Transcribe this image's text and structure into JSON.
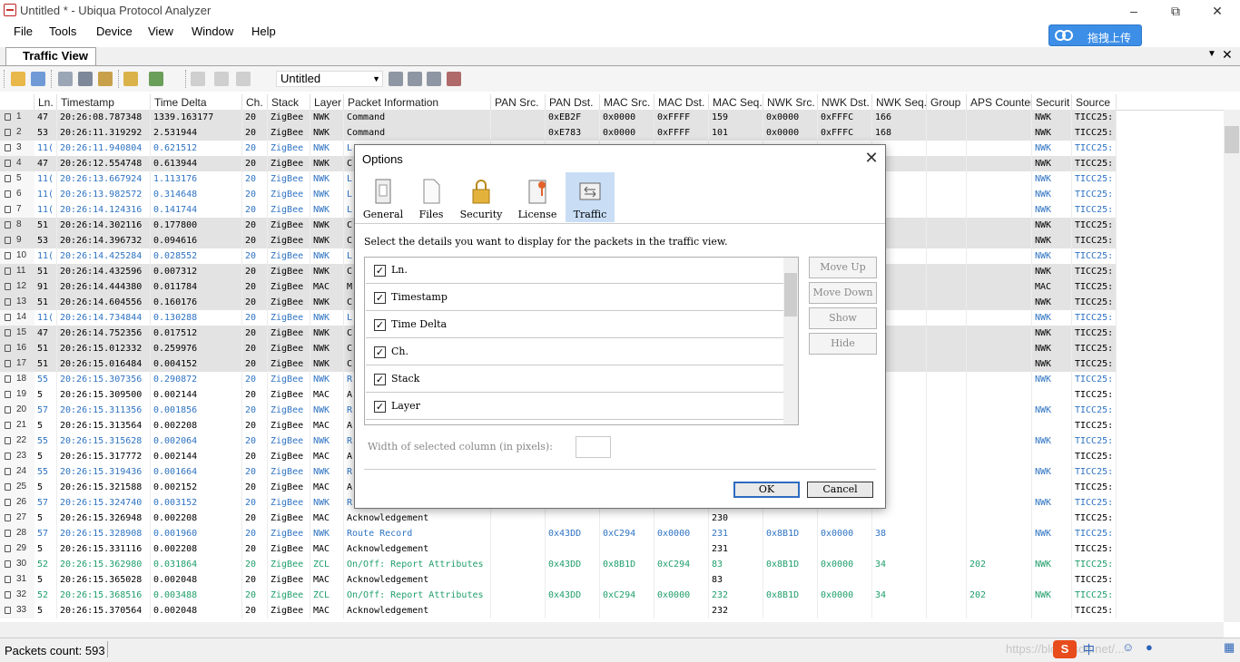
{
  "window": {
    "title": "Untitled * - Ubiqua Protocol Analyzer"
  },
  "menu": [
    "File",
    "Tools",
    "Device",
    "View",
    "Window",
    "Help"
  ],
  "cloud_button": {
    "label": "拖拽上传"
  },
  "tab": {
    "label": "Traffic View"
  },
  "toolbar": {
    "combo_value": "Untitled"
  },
  "columns": [
    "Ln.",
    "Timestamp",
    "Time Delta",
    "Ch.",
    "Stack",
    "Layer",
    "Packet Information",
    "PAN Src.",
    "PAN Dst.",
    "MAC Src.",
    "MAC Dst.",
    "MAC Seq.",
    "NWK Src.",
    "NWK Dst.",
    "NWK Seq.",
    "Group",
    "APS Counter",
    "Securit",
    "Source"
  ],
  "rows": [
    {
      "n": "1",
      "ln": "47",
      "ts": "20:26:08.787348",
      "td": "1339.163177",
      "ch": "20",
      "st": "ZigBee",
      "ly": "NWK",
      "pi": "Command",
      "ps": "",
      "pd": "0xEB2F",
      "ms": "0x0000",
      "md": "0xFFFF",
      "mq": "159",
      "ns": "0x0000",
      "nd": "0xFFFC",
      "nq": "166",
      "gr": "",
      "ac": "",
      "se": "NWK",
      "so": "TICC25:"
    },
    {
      "n": "2",
      "ln": "53",
      "ts": "20:26:11.319292",
      "td": "2.531944",
      "ch": "20",
      "st": "ZigBee",
      "ly": "NWK",
      "pi": "Command",
      "ps": "",
      "pd": "0xE783",
      "ms": "0x0000",
      "md": "0xFFFF",
      "mq": "101",
      "ns": "0x0000",
      "nd": "0xFFFC",
      "nq": "168",
      "gr": "",
      "ac": "",
      "se": "NWK",
      "so": "TICC25:"
    },
    {
      "n": "3",
      "ln": "11(",
      "ts": "20:26:11.940804",
      "td": "0.621512",
      "ch": "20",
      "st": "ZigBee",
      "ly": "NWK",
      "pi": "L",
      "ps": "",
      "pd": "",
      "ms": "",
      "md": "",
      "mq": "",
      "ns": "",
      "nd": "",
      "nq": "",
      "gr": "",
      "ac": "",
      "se": "NWK",
      "so": "TICC25:"
    },
    {
      "n": "4",
      "ln": "47",
      "ts": "20:26:12.554748",
      "td": "0.613944",
      "ch": "20",
      "st": "ZigBee",
      "ly": "NWK",
      "pi": "C",
      "ps": "",
      "pd": "",
      "ms": "",
      "md": "",
      "mq": "",
      "ns": "",
      "nd": "",
      "nq": "",
      "gr": "",
      "ac": "",
      "se": "NWK",
      "so": "TICC25:"
    },
    {
      "n": "5",
      "ln": "11(",
      "ts": "20:26:13.667924",
      "td": "1.113176",
      "ch": "20",
      "st": "ZigBee",
      "ly": "NWK",
      "pi": "L",
      "ps": "",
      "pd": "",
      "ms": "",
      "md": "",
      "mq": "",
      "ns": "",
      "nd": "",
      "nq": "00",
      "gr": "",
      "ac": "",
      "se": "NWK",
      "so": "TICC25:"
    },
    {
      "n": "6",
      "ln": "11(",
      "ts": "20:26:13.982572",
      "td": "0.314648",
      "ch": "20",
      "st": "ZigBee",
      "ly": "NWK",
      "pi": "L",
      "ps": "",
      "pd": "",
      "ms": "",
      "md": "",
      "mq": "",
      "ns": "",
      "nd": "",
      "nq": "5",
      "gr": "",
      "ac": "",
      "se": "NWK",
      "so": "TICC25:"
    },
    {
      "n": "7",
      "ln": "11(",
      "ts": "20:26:14.124316",
      "td": "0.141744",
      "ch": "20",
      "st": "ZigBee",
      "ly": "NWK",
      "pi": "L",
      "ps": "",
      "pd": "",
      "ms": "",
      "md": "",
      "mq": "",
      "ns": "",
      "nd": "",
      "nq": "37",
      "gr": "",
      "ac": "",
      "se": "NWK",
      "so": "TICC25:"
    },
    {
      "n": "8",
      "ln": "51",
      "ts": "20:26:14.302116",
      "td": "0.177800",
      "ch": "20",
      "st": "ZigBee",
      "ly": "NWK",
      "pi": "C",
      "ps": "",
      "pd": "",
      "ms": "",
      "md": "",
      "mq": "",
      "ns": "",
      "nd": "",
      "nq": "59",
      "gr": "",
      "ac": "",
      "se": "NWK",
      "so": "TICC25:"
    },
    {
      "n": "9",
      "ln": "53",
      "ts": "20:26:14.396732",
      "td": "0.094616",
      "ch": "20",
      "st": "ZigBee",
      "ly": "NWK",
      "pi": "C",
      "ps": "",
      "pd": "",
      "ms": "",
      "md": "",
      "mq": "",
      "ns": "",
      "nd": "",
      "nq": "",
      "gr": "",
      "ac": "",
      "se": "NWK",
      "so": "TICC25:"
    },
    {
      "n": "10",
      "ln": "11(",
      "ts": "20:26:14.425284",
      "td": "0.028552",
      "ch": "20",
      "st": "ZigBee",
      "ly": "NWK",
      "pi": "L",
      "ps": "",
      "pd": "",
      "ms": "",
      "md": "",
      "mq": "",
      "ns": "",
      "nd": "",
      "nq": "00",
      "gr": "",
      "ac": "",
      "se": "NWK",
      "so": "TICC25:"
    },
    {
      "n": "11",
      "ln": "51",
      "ts": "20:26:14.432596",
      "td": "0.007312",
      "ch": "20",
      "st": "ZigBee",
      "ly": "NWK",
      "pi": "C",
      "ps": "",
      "pd": "",
      "ms": "",
      "md": "",
      "mq": "",
      "ns": "",
      "nd": "",
      "nq": "59",
      "gr": "",
      "ac": "",
      "se": "NWK",
      "so": "TICC25:"
    },
    {
      "n": "12",
      "ln": "91",
      "ts": "20:26:14.444380",
      "td": "0.011784",
      "ch": "20",
      "st": "ZigBee",
      "ly": "MAC",
      "pi": "M",
      "ps": "",
      "pd": "",
      "ms": "",
      "md": "",
      "mq": "",
      "ns": "",
      "nd": "",
      "nq": "",
      "gr": "",
      "ac": "",
      "se": "MAC",
      "so": "TICC25:"
    },
    {
      "n": "13",
      "ln": "51",
      "ts": "20:26:14.604556",
      "td": "0.160176",
      "ch": "20",
      "st": "ZigBee",
      "ly": "NWK",
      "pi": "C",
      "ps": "",
      "pd": "",
      "ms": "",
      "md": "",
      "mq": "",
      "ns": "",
      "nd": "",
      "nq": "59",
      "gr": "",
      "ac": "",
      "se": "NWK",
      "so": "TICC25:"
    },
    {
      "n": "14",
      "ln": "11(",
      "ts": "20:26:14.734844",
      "td": "0.130288",
      "ch": "20",
      "st": "ZigBee",
      "ly": "NWK",
      "pi": "L",
      "ps": "",
      "pd": "",
      "ms": "",
      "md": "",
      "mq": "",
      "ns": "",
      "nd": "",
      "nq": "",
      "gr": "",
      "ac": "",
      "se": "NWK",
      "so": "TICC25:"
    },
    {
      "n": "15",
      "ln": "47",
      "ts": "20:26:14.752356",
      "td": "0.017512",
      "ch": "20",
      "st": "ZigBee",
      "ly": "NWK",
      "pi": "C",
      "ps": "",
      "pd": "",
      "ms": "",
      "md": "",
      "mq": "",
      "ns": "",
      "nd": "",
      "nq": "",
      "gr": "",
      "ac": "",
      "se": "NWK",
      "so": "TICC25:"
    },
    {
      "n": "16",
      "ln": "51",
      "ts": "20:26:15.012332",
      "td": "0.259976",
      "ch": "20",
      "st": "ZigBee",
      "ly": "NWK",
      "pi": "C",
      "ps": "",
      "pd": "",
      "ms": "",
      "md": "",
      "mq": "",
      "ns": "",
      "nd": "",
      "nq": "59",
      "gr": "",
      "ac": "",
      "se": "NWK",
      "so": "TICC25:"
    },
    {
      "n": "17",
      "ln": "51",
      "ts": "20:26:15.016484",
      "td": "0.004152",
      "ch": "20",
      "st": "ZigBee",
      "ly": "NWK",
      "pi": "C",
      "ps": "",
      "pd": "",
      "ms": "",
      "md": "",
      "mq": "",
      "ns": "",
      "nd": "",
      "nq": "59",
      "gr": "",
      "ac": "",
      "se": "NWK",
      "so": "TICC25:"
    },
    {
      "n": "18",
      "ln": "55",
      "ts": "20:26:15.307356",
      "td": "0.290872",
      "ch": "20",
      "st": "ZigBee",
      "ly": "NWK",
      "pi": "R",
      "ps": "",
      "pd": "",
      "ms": "",
      "md": "",
      "mq": "",
      "ns": "",
      "nd": "",
      "nq": "2",
      "gr": "",
      "ac": "",
      "se": "NWK",
      "so": "TICC25:"
    },
    {
      "n": "19",
      "ln": "5",
      "ts": "20:26:15.309500",
      "td": "0.002144",
      "ch": "20",
      "st": "ZigBee",
      "ly": "MAC",
      "pi": "A",
      "ps": "",
      "pd": "",
      "ms": "",
      "md": "",
      "mq": "",
      "ns": "",
      "nd": "",
      "nq": "",
      "gr": "",
      "ac": "",
      "se": "",
      "so": "TICC25:"
    },
    {
      "n": "20",
      "ln": "57",
      "ts": "20:26:15.311356",
      "td": "0.001856",
      "ch": "20",
      "st": "ZigBee",
      "ly": "NWK",
      "pi": "R",
      "ps": "",
      "pd": "",
      "ms": "",
      "md": "",
      "mq": "",
      "ns": "",
      "nd": "",
      "nq": "2",
      "gr": "",
      "ac": "",
      "se": "NWK",
      "so": "TICC25:"
    },
    {
      "n": "21",
      "ln": "5",
      "ts": "20:26:15.313564",
      "td": "0.002208",
      "ch": "20",
      "st": "ZigBee",
      "ly": "MAC",
      "pi": "A",
      "ps": "",
      "pd": "",
      "ms": "",
      "md": "",
      "mq": "",
      "ns": "",
      "nd": "",
      "nq": "",
      "gr": "",
      "ac": "",
      "se": "",
      "so": "TICC25:"
    },
    {
      "n": "22",
      "ln": "55",
      "ts": "20:26:15.315628",
      "td": "0.002064",
      "ch": "20",
      "st": "ZigBee",
      "ly": "NWK",
      "pi": "R",
      "ps": "",
      "pd": "",
      "ms": "",
      "md": "",
      "mq": "",
      "ns": "",
      "nd": "",
      "nq": "5",
      "gr": "",
      "ac": "",
      "se": "NWK",
      "so": "TICC25:"
    },
    {
      "n": "23",
      "ln": "5",
      "ts": "20:26:15.317772",
      "td": "0.002144",
      "ch": "20",
      "st": "ZigBee",
      "ly": "MAC",
      "pi": "A",
      "ps": "",
      "pd": "",
      "ms": "",
      "md": "",
      "mq": "",
      "ns": "",
      "nd": "",
      "nq": "",
      "gr": "",
      "ac": "",
      "se": "",
      "so": "TICC25:"
    },
    {
      "n": "24",
      "ln": "55",
      "ts": "20:26:15.319436",
      "td": "0.001664",
      "ch": "20",
      "st": "ZigBee",
      "ly": "NWK",
      "pi": "R",
      "ps": "",
      "pd": "",
      "ms": "",
      "md": "",
      "mq": "",
      "ns": "",
      "nd": "",
      "nq": "8",
      "gr": "",
      "ac": "",
      "se": "NWK",
      "so": "TICC25:"
    },
    {
      "n": "25",
      "ln": "5",
      "ts": "20:26:15.321588",
      "td": "0.002152",
      "ch": "20",
      "st": "ZigBee",
      "ly": "MAC",
      "pi": "A",
      "ps": "",
      "pd": "",
      "ms": "",
      "md": "",
      "mq": "",
      "ns": "",
      "nd": "",
      "nq": "",
      "gr": "",
      "ac": "",
      "se": "",
      "so": "TICC25:"
    },
    {
      "n": "26",
      "ln": "57",
      "ts": "20:26:15.324740",
      "td": "0.003152",
      "ch": "20",
      "st": "ZigBee",
      "ly": "NWK",
      "pi": "R",
      "ps": "",
      "pd": "",
      "ms": "",
      "md": "",
      "mq": "",
      "ns": "",
      "nd": "",
      "nq": "",
      "gr": "",
      "ac": "",
      "se": "NWK",
      "so": "TICC25:"
    },
    {
      "n": "27",
      "ln": "5",
      "ts": "20:26:15.326948",
      "td": "0.002208",
      "ch": "20",
      "st": "ZigBee",
      "ly": "MAC",
      "pi": "Acknowledgement",
      "ps": "",
      "pd": "",
      "ms": "",
      "md": "",
      "mq": "230",
      "ns": "",
      "nd": "",
      "nq": "",
      "gr": "",
      "ac": "",
      "se": "",
      "so": "TICC25:"
    },
    {
      "n": "28",
      "ln": "57",
      "ts": "20:26:15.328908",
      "td": "0.001960",
      "ch": "20",
      "st": "ZigBee",
      "ly": "NWK",
      "pi": "Route Record",
      "ps": "",
      "pd": "0x43DD",
      "ms": "0xC294",
      "md": "0x0000",
      "mq": "231",
      "ns": "0x8B1D",
      "nd": "0x0000",
      "nq": "38",
      "gr": "",
      "ac": "",
      "se": "NWK",
      "so": "TICC25:"
    },
    {
      "n": "29",
      "ln": "5",
      "ts": "20:26:15.331116",
      "td": "0.002208",
      "ch": "20",
      "st": "ZigBee",
      "ly": "MAC",
      "pi": "Acknowledgement",
      "ps": "",
      "pd": "",
      "ms": "",
      "md": "",
      "mq": "231",
      "ns": "",
      "nd": "",
      "nq": "",
      "gr": "",
      "ac": "",
      "se": "",
      "so": "TICC25:"
    },
    {
      "n": "30",
      "ln": "52",
      "ts": "20:26:15.362980",
      "td": "0.031864",
      "ch": "20",
      "st": "ZigBee",
      "ly": "ZCL",
      "pi": "On/Off: Report Attributes",
      "ps": "",
      "pd": "0x43DD",
      "ms": "0x8B1D",
      "md": "0xC294",
      "mq": "83",
      "ns": "0x8B1D",
      "nd": "0x0000",
      "nq": "34",
      "gr": "",
      "ac": "202",
      "se": "NWK",
      "so": "TICC25:"
    },
    {
      "n": "31",
      "ln": "5",
      "ts": "20:26:15.365028",
      "td": "0.002048",
      "ch": "20",
      "st": "ZigBee",
      "ly": "MAC",
      "pi": "Acknowledgement",
      "ps": "",
      "pd": "",
      "ms": "",
      "md": "",
      "mq": "83",
      "ns": "",
      "nd": "",
      "nq": "",
      "gr": "",
      "ac": "",
      "se": "",
      "so": "TICC25:"
    },
    {
      "n": "32",
      "ln": "52",
      "ts": "20:26:15.368516",
      "td": "0.003488",
      "ch": "20",
      "st": "ZigBee",
      "ly": "ZCL",
      "pi": "On/Off: Report Attributes",
      "ps": "",
      "pd": "0x43DD",
      "ms": "0xC294",
      "md": "0x0000",
      "mq": "232",
      "ns": "0x8B1D",
      "nd": "0x0000",
      "nq": "34",
      "gr": "",
      "ac": "202",
      "se": "NWK",
      "so": "TICC25:"
    },
    {
      "n": "33",
      "ln": "5",
      "ts": "20:26:15.370564",
      "td": "0.002048",
      "ch": "20",
      "st": "ZigBee",
      "ly": "MAC",
      "pi": "Acknowledgement",
      "ps": "",
      "pd": "",
      "ms": "",
      "md": "",
      "mq": "232",
      "ns": "",
      "nd": "",
      "nq": "",
      "gr": "",
      "ac": "",
      "se": "",
      "so": "TICC25:"
    }
  ],
  "row_styles": [
    "gray",
    "gray",
    "blue",
    "gray",
    "blue",
    "blue",
    "blue",
    "gray",
    "gray",
    "blue",
    "gray",
    "gray",
    "gray",
    "blue",
    "gray",
    "gray",
    "gray",
    "blue",
    "plain",
    "blue",
    "plain",
    "blue",
    "plain",
    "blue",
    "plain",
    "blue",
    "plain",
    "blue",
    "plain",
    "green",
    "plain",
    "green",
    "plain"
  ],
  "status": {
    "packets": "Packets count: 593",
    "watermark": "https://blog.csdn.net/..."
  },
  "dialog": {
    "title": "Options",
    "tabs": [
      "General",
      "Files",
      "Security",
      "License",
      "Traffic"
    ],
    "active_tab": "Traffic",
    "description": "Select the details you want to display for the packets in the traffic view.",
    "list_items": [
      "Ln.",
      "Timestamp",
      "Time Delta",
      "Ch.",
      "Stack",
      "Layer"
    ],
    "buttons_side": [
      "Move Up",
      "Move Down",
      "Show",
      "Hide"
    ],
    "width_label": "Width of selected column (in pixels):",
    "ok_label": "OK",
    "cancel_label": "Cancel"
  },
  "colors": {
    "blue_text": "#2e73c2",
    "green_text": "#1f9e6a",
    "gray_row": "#e3e3e3",
    "active_tab": "#c9def5"
  }
}
